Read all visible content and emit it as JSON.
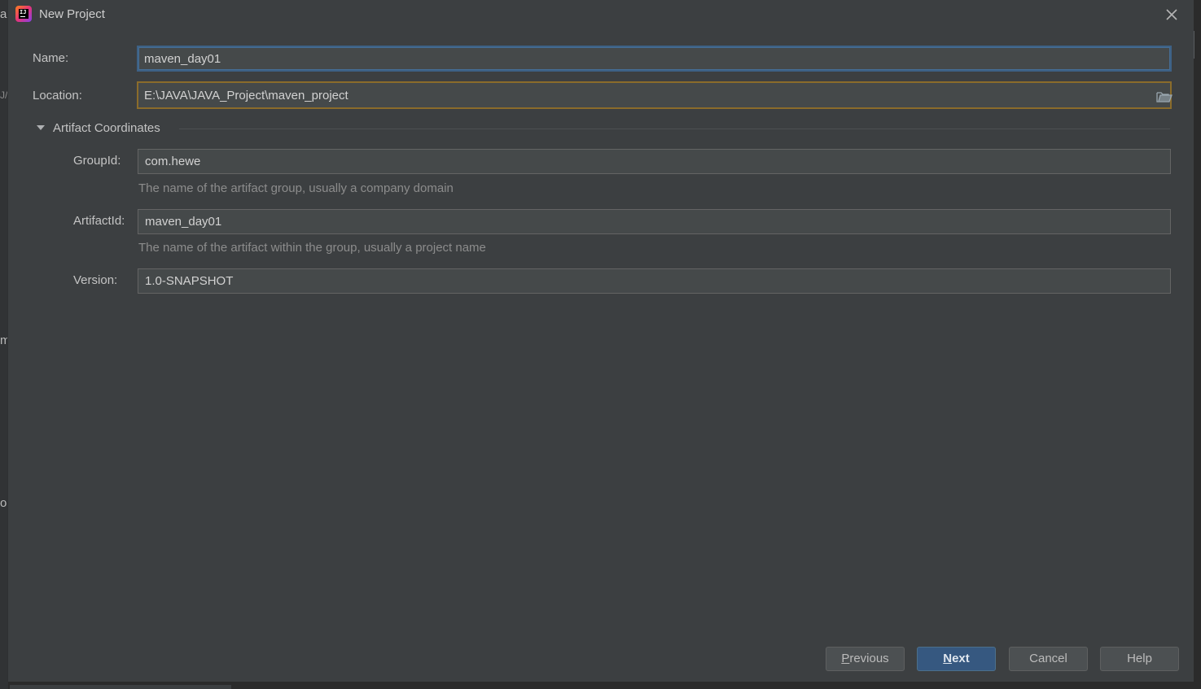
{
  "background": {
    "fragments": [
      "a",
      "J/",
      "m",
      "ol"
    ]
  },
  "dialog": {
    "title": "New Project",
    "icons": {
      "app": "intellij-idea-icon",
      "close": "close-icon",
      "browse": "folder-open-icon",
      "toggle": "triangle-down-icon"
    }
  },
  "form": {
    "name": {
      "label": "Name:",
      "value": "maven_day01"
    },
    "location": {
      "label": "Location:",
      "value": "E:\\JAVA\\JAVA_Project\\maven_project"
    },
    "artifact_section": {
      "title": "Artifact Coordinates",
      "expanded": true
    },
    "group_id": {
      "label": "GroupId:",
      "value": "com.hewe",
      "hint": "The name of the artifact group, usually a company domain"
    },
    "artifact_id": {
      "label": "ArtifactId:",
      "value": "maven_day01",
      "hint": "The name of the artifact within the group, usually a project name"
    },
    "version": {
      "label": "Version:",
      "value": "1.0-SNAPSHOT"
    }
  },
  "buttons": {
    "previous": {
      "mnemonic": "P",
      "rest": "revious"
    },
    "next": {
      "mnemonic": "N",
      "rest": "ext"
    },
    "cancel": "Cancel",
    "help": "Help"
  },
  "colors": {
    "dialog_bg": "#3c3f41",
    "focus_border": "#3d6185",
    "warning_border": "#8b6c2b",
    "primary_button": "#365880"
  }
}
